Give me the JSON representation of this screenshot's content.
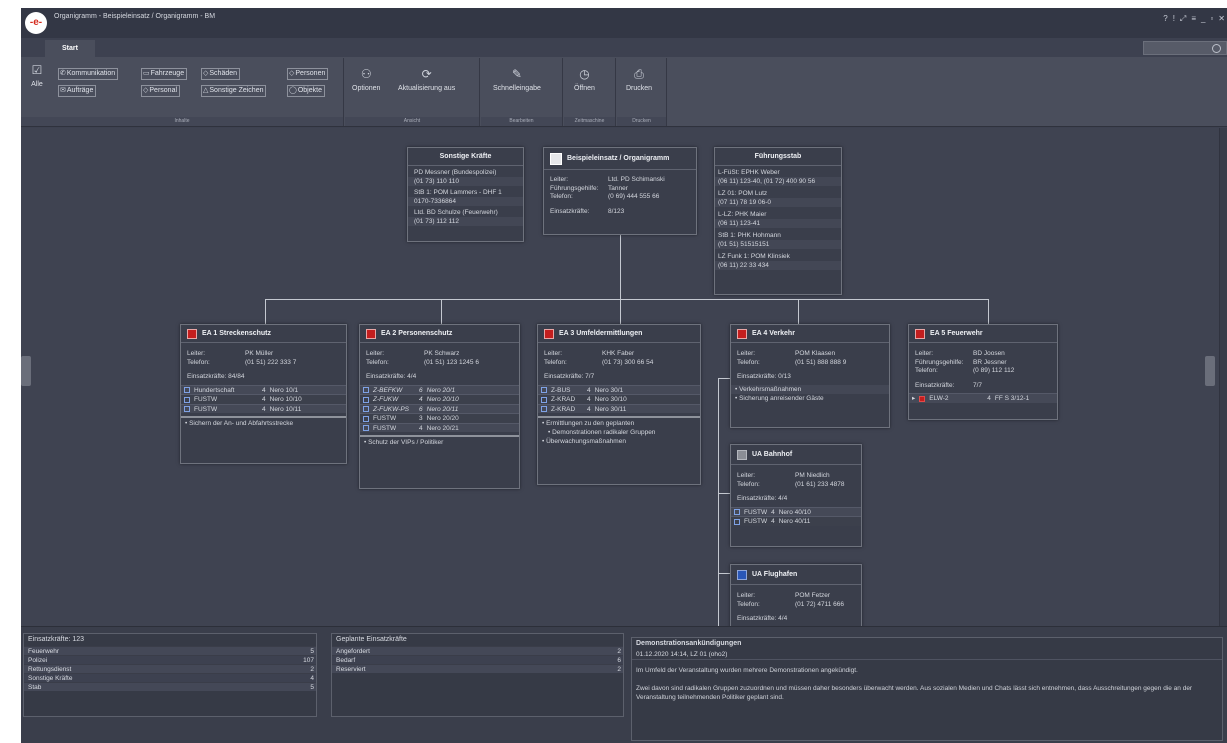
{
  "window": {
    "title": "Organigramm - Beispieleinsatz / Organigramm - BM",
    "logo_text": "-e-",
    "controls": [
      "?",
      "!",
      "⤢",
      "≡",
      "_",
      "▫",
      "✕"
    ]
  },
  "ribbon": {
    "tab": "Start",
    "groups": {
      "inhalte": {
        "label": "Inhalte",
        "alle": "Alle",
        "chips": [
          "Kommunikation",
          "Fahrzeuge",
          "Schäden",
          "Personen",
          "Aufträge",
          "Personal",
          "Sonstige Zeichen",
          "Objekte"
        ]
      },
      "ansicht": {
        "label": "Ansicht",
        "optionen": "Optionen",
        "aktualisierung": "Aktualisierung aus"
      },
      "bearbeiten": {
        "label": "Bearbeiten",
        "schnelleingabe": "Schnelleingabe"
      },
      "zeitmaschine": {
        "label": "Zeitmaschine",
        "oeffnen": "Öffnen"
      },
      "drucken": {
        "label": "Drucken",
        "drucken": "Drucken"
      }
    }
  },
  "org": {
    "sonstige": {
      "title": "Sonstige Kräfte",
      "lines": [
        "PD Messner (Bundespolizei)",
        "(01 73) 110 110",
        "StB 1: POM Lammers - DHF 1",
        "0170-7336864",
        "Ltd. BD Schulze (Feuerwehr)",
        "(01 73) 112 112"
      ]
    },
    "main": {
      "title": "Beispieleinsatz / Organigramm",
      "leiter_k": "Leiter:",
      "leiter_v": "Ltd. PD Schimanski",
      "fg_k": "Führungsgehilfe:",
      "fg_v": "Tanner",
      "tel_k": "Telefon:",
      "tel_v": "(0 69) 444 555 66",
      "ek_k": "Einsatzkräfte:",
      "ek_v": "8/123"
    },
    "stab": {
      "title": "Führungsstab",
      "lines": [
        "L-FüSt: EPHK Weber",
        "(06 11) 123-40, (01 72) 400 90 56",
        "LZ 01: POM Lutz",
        "(07 11) 78 19 06-0",
        "L-LZ: PHK Maier",
        "(06 11) 123-41",
        "StB 1: PHK Hohmann",
        "(01 51) 51515151",
        "LZ Funk 1: POM Klinsiek",
        "(06 11) 22 33 434"
      ]
    },
    "ea1": {
      "title": "EA 1 Streckenschutz",
      "leiter": "PK Müller",
      "telefon": "(01 51) 222 333 7",
      "ek": "Einsatzkräfte: 84/84",
      "units": [
        {
          "name": "Hundertschaft",
          "n": "4",
          "call": "Nero 10/1"
        },
        {
          "name": "FUSTW",
          "n": "4",
          "call": "Nero 10/10"
        },
        {
          "name": "FUSTW",
          "n": "4",
          "call": "Nero 10/11"
        }
      ],
      "tasks": [
        "Sichern der An- und Abfahrtsstrecke"
      ]
    },
    "ea2": {
      "title": "EA 2 Personenschutz",
      "leiter": "PK Schwarz",
      "telefon": "(01 51) 123 1245 6",
      "ek": "Einsatzkräfte: 4/4",
      "units": [
        {
          "name": "Z-BEFKW",
          "n": "6",
          "call": "Nero 20/1"
        },
        {
          "name": "Z-FUKW",
          "n": "4",
          "call": "Nero 20/10"
        },
        {
          "name": "Z-FUKW-PS",
          "n": "6",
          "call": "Nero 20/11"
        },
        {
          "name": "FUSTW",
          "n": "3",
          "call": "Nero 20/20"
        },
        {
          "name": "FUSTW",
          "n": "4",
          "call": "Nero 20/21"
        }
      ],
      "tasks": [
        "Schutz der VIPs / Politiker"
      ]
    },
    "ea3": {
      "title": "EA 3 Umfeldermittlungen",
      "leiter": "KHK Faber",
      "telefon": "(01 73) 300 66 54",
      "ek": "Einsatzkräfte: 7/7",
      "units": [
        {
          "name": "Z-BUS",
          "n": "4",
          "call": "Nero 30/1"
        },
        {
          "name": "Z-KRAD",
          "n": "4",
          "call": "Nero 30/10"
        },
        {
          "name": "Z-KRAD",
          "n": "4",
          "call": "Nero 30/11"
        }
      ],
      "tasks": [
        "Ermittlungen zu den geplanten",
        "Überwachungsmaßnahmen"
      ],
      "task_cont": "Demonstrationen radikaler Gruppen"
    },
    "ea4": {
      "title": "EA 4 Verkehr",
      "leiter": "POM Klaasen",
      "telefon": "(01 51) 888 888 9",
      "ek": "Einsatzkräfte: 0/13",
      "tasks": [
        "Verkehrsmaßnahmen",
        "Sicherung anreisender Gäste"
      ]
    },
    "ea5": {
      "title": "EA 5 Feuerwehr",
      "leiter": "BD Joosen",
      "fg_k": "Führungsgehilfe:",
      "fg_v": "BR Jessner",
      "telefon": "(0 89) 112 112",
      "ek_k": "Einsatzkräfte:",
      "ek_v": "7/7",
      "units": [
        {
          "name": "ELW-2",
          "n": "4",
          "call": "FF S 3/12-1"
        }
      ]
    },
    "bahnhof": {
      "title": "UA Bahnhof",
      "leiter": "PM Niedlich",
      "telefon": "(01 61) 233 4878",
      "ek": "Einsatzkräfte: 4/4",
      "units": [
        {
          "name": "FUSTW",
          "n": "4",
          "call": "Nero 40/10"
        },
        {
          "name": "FUSTW",
          "n": "4",
          "call": "Nero 40/11"
        }
      ]
    },
    "flughafen": {
      "title": "UA Flughafen",
      "leiter": "POM Fetzer",
      "telefon": "(01 72) 4711 666",
      "ek": "Einsatzkräfte: 4/4"
    },
    "labels": {
      "leiter": "Leiter:",
      "telefon": "Telefon:",
      "fg": "Führungsgehilfe:"
    }
  },
  "bottom": {
    "einsatzkraefte": {
      "title": "Einsatzkräfte: 123",
      "rows": [
        {
          "label": "Feuerwehr",
          "value": "5"
        },
        {
          "label": "Polizei",
          "value": "107"
        },
        {
          "label": "Rettungsdienst",
          "value": "2"
        },
        {
          "label": "Sonstige Kräfte",
          "value": "4"
        },
        {
          "label": "Stab",
          "value": "5"
        }
      ]
    },
    "geplant": {
      "title": "Geplante Einsatzkräfte",
      "rows": [
        {
          "label": "Angefordert",
          "value": "2"
        },
        {
          "label": "Bedarf",
          "value": "6"
        },
        {
          "label": "Reserviert",
          "value": "2"
        }
      ]
    },
    "message": {
      "title": "Demonstrationsankündigungen",
      "sub": "01.12.2020 14:14, LZ 01 (oho2)",
      "p1": "Im Umfeld der Veranstaltung wurden mehrere Demonstrationen angekündigt.",
      "p2": "Zwei davon sind radikalen Gruppen zuzuordnen und müssen daher besonders überwacht werden. Aus sozialen Medien und Chats lässt sich entnehmen, dass Ausschreitungen gegen die an der Veranstaltung teilnehmenden Politiker geplant sind."
    }
  }
}
